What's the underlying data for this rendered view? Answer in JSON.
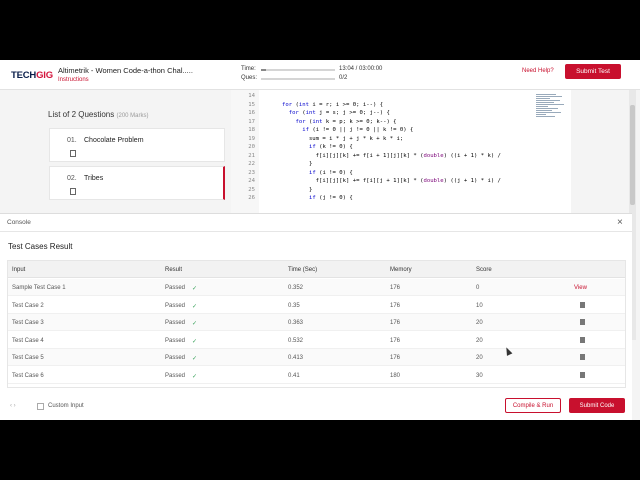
{
  "header": {
    "logo_a": "TECH",
    "logo_b": "GIG",
    "contest_title": "Altimetrik - Women Code-a-thon Chal.....",
    "instructions": "Instructions",
    "time_label": "Time:",
    "time_value": "13:04 / 03:00:00",
    "time_progress": 0.07,
    "ques_label": "Ques:",
    "ques_value": "0/2",
    "ques_progress": 0,
    "need_help": "Need Help?",
    "submit_test": "Submit Test"
  },
  "questions": {
    "title": "List of 2 Questions",
    "marks": "(200 Marks)",
    "items": [
      {
        "num": "01.",
        "name": "Chocolate Problem"
      },
      {
        "num": "02.",
        "name": "Tribes"
      }
    ]
  },
  "editor": {
    "lines": [
      {
        "n": "14",
        "code": ""
      },
      {
        "n": "15",
        "code": "for (int i = r; i >= 0; i--) {"
      },
      {
        "n": "16",
        "code": "  for (int j = s; j >= 0; j--) {"
      },
      {
        "n": "17",
        "code": "    for (int k = p; k >= 0; k--) {"
      },
      {
        "n": "18",
        "code": "      if (i != 0 || j != 0 || k != 0) {"
      },
      {
        "n": "19",
        "code": "        sum = i * j + j * k + k * i;"
      },
      {
        "n": "20",
        "code": "        if (k != 0) {"
      },
      {
        "n": "21",
        "code": "          f[i][j][k] += f[i + 1][j][k] * (double) ((i + 1) * k) /"
      },
      {
        "n": "22",
        "code": "        }"
      },
      {
        "n": "23",
        "code": "        if (i != 0) {"
      },
      {
        "n": "24",
        "code": "          f[i][j][k] += f[i][j + 1][k] * (double) ((j + 1) * i) /"
      },
      {
        "n": "25",
        "code": "        }"
      },
      {
        "n": "26",
        "code": "        if (j != 0) {"
      }
    ]
  },
  "console": {
    "label": "Console",
    "close": "×",
    "result_title": "Test Cases Result",
    "columns": [
      "Input",
      "Result",
      "Time (Sec)",
      "Memory",
      "Score"
    ],
    "rows": [
      {
        "input": "Sample Test Case 1",
        "result": "Passed",
        "time": "0.352",
        "memory": "176",
        "score": "0",
        "action": "View"
      },
      {
        "input": "Test Case 2",
        "result": "Passed",
        "time": "0.35",
        "memory": "176",
        "score": "10",
        "action": ""
      },
      {
        "input": "Test Case 3",
        "result": "Passed",
        "time": "0.363",
        "memory": "176",
        "score": "20",
        "action": ""
      },
      {
        "input": "Test Case 4",
        "result": "Passed",
        "time": "0.532",
        "memory": "176",
        "score": "20",
        "action": ""
      },
      {
        "input": "Test Case 5",
        "result": "Passed",
        "time": "0.413",
        "memory": "176",
        "score": "20",
        "action": ""
      },
      {
        "input": "Test Case 6",
        "result": "Passed",
        "time": "0.41",
        "memory": "180",
        "score": "30",
        "action": ""
      }
    ],
    "check_glyph": "✓",
    "nav_arrows": "‹ ›",
    "custom_input": "Custom Input",
    "compile_run": "Compile & Run",
    "submit_code": "Submit Code"
  }
}
